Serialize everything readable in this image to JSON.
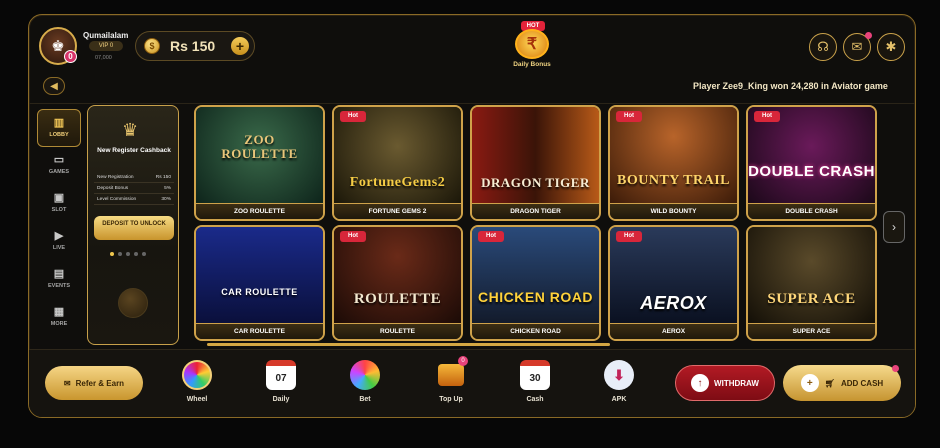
{
  "header": {
    "username": "Qumailalam",
    "vip": "VIP 0",
    "user_id": "07,000",
    "avatar_badge": "0",
    "balance": "Rs 150",
    "bonus_hot": "HOT",
    "bonus_label": "Daily Bonus",
    "bonus_symbol": "₹"
  },
  "marquee": {
    "text": "Player Zee9_King won 24,280 in Aviator game"
  },
  "nav": [
    {
      "label": "LOBBY",
      "icon": "lobby-icon"
    },
    {
      "label": "GAMES",
      "icon": "games-icon"
    },
    {
      "label": "SLOT",
      "icon": "slot-icon"
    },
    {
      "label": "LIVE",
      "icon": "live-icon"
    },
    {
      "label": "EVENTS",
      "icon": "events-icon"
    },
    {
      "label": "MORE",
      "icon": "more-icon"
    }
  ],
  "promo": {
    "title": "New Register Cashback",
    "rows": [
      {
        "k": "New Registration",
        "v": "Rs 150"
      },
      {
        "k": "Deposit Bonus",
        "v": "5%"
      },
      {
        "k": "Level Commission",
        "v": "30%"
      }
    ],
    "button": "DEPOSIT TO UNLOCK"
  },
  "games": [
    {
      "name": "ZOO ROULETTE",
      "art": "ZOO\nROULETTE",
      "hot": false
    },
    {
      "name": "FORTUNE GEMS 2",
      "art": "FortuneGems2",
      "hot": true
    },
    {
      "name": "DRAGON TIGER",
      "art": "DRAGON TIGER",
      "hot": false
    },
    {
      "name": "WILD BOUNTY",
      "art": "BOUNTY TRAIL",
      "hot": true
    },
    {
      "name": "DOUBLE CRASH",
      "art": "DOUBLE CRASH",
      "hot": true
    },
    {
      "name": "CAR ROULETTE",
      "art": "CAR ROULETTE",
      "hot": false
    },
    {
      "name": "ROULETTE",
      "art": "ROULETTE",
      "hot": true
    },
    {
      "name": "CHICKEN ROAD",
      "art": "CHICKEN ROAD",
      "hot": true
    },
    {
      "name": "AEROX",
      "art": "AEROX",
      "hot": true
    },
    {
      "name": "SUPER ACE",
      "art": "SUPER ACE",
      "hot": false
    }
  ],
  "hot_label": "Hot",
  "bottom": {
    "refer": "Refer & Earn",
    "quick": [
      {
        "label": "Wheel",
        "icon": "wheel-icon"
      },
      {
        "label": "Daily",
        "icon": "calendar-icon",
        "value": "07"
      },
      {
        "label": "Bet",
        "icon": "bet-icon"
      },
      {
        "label": "Top Up",
        "icon": "topup-icon",
        "badge": "0"
      },
      {
        "label": "Cash",
        "icon": "cash-icon",
        "value": "30"
      },
      {
        "label": "APK",
        "icon": "apk-icon"
      }
    ],
    "withdraw": "WITHDRAW",
    "add_cash": "ADD CASH"
  },
  "colors": {
    "gold": "#cfa24a",
    "hot": "#d8263a",
    "withdraw": "#b21a24"
  }
}
